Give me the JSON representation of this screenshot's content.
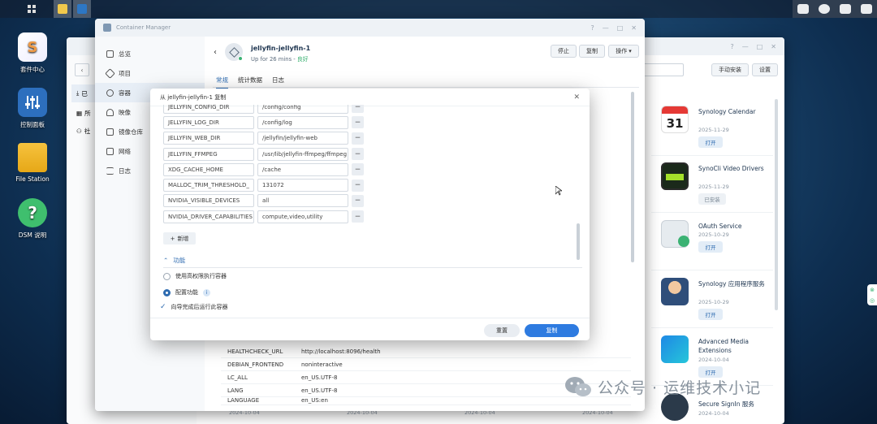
{
  "desktop": {
    "icons": [
      {
        "label": "套件中心",
        "icon": "package-center-icon"
      },
      {
        "label": "控制面板",
        "icon": "control-panel-icon"
      },
      {
        "label": "File Station",
        "icon": "folder-icon"
      },
      {
        "label": "DSM 说明",
        "icon": "help-icon"
      }
    ]
  },
  "package_window": {
    "manual_install_label": "手动安装",
    "settings_label": "设置",
    "packages": [
      {
        "name": "Synology Calendar",
        "date": "2025-11-29",
        "action": "打开",
        "icon": "calendar-icon",
        "icon_text": "31"
      },
      {
        "name": "SynoCli Video Drivers",
        "date": "2025-11-29",
        "action": "已安装",
        "icon": "video-drivers-icon"
      },
      {
        "name": "OAuth Service",
        "date": "2025-10-29",
        "action": "打开",
        "icon": "oauth-icon"
      },
      {
        "name": "Synology 应用程序服务",
        "date": "2025-10-29",
        "action": "打开",
        "icon": "app-service-icon"
      },
      {
        "name": "Advanced Media Extensions",
        "date": "2024-10-04",
        "action": "打开",
        "icon": "media-extensions-icon"
      },
      {
        "name": "Secure SignIn 服务",
        "date": "2024-10-04",
        "action": "",
        "icon": "secure-signin-icon"
      }
    ],
    "bottom_dates": [
      "2024-10-04",
      "2024-10-04",
      "2024-10-04",
      "2024-10-04"
    ]
  },
  "container_manager": {
    "title": "Container Manager",
    "sidebar": [
      {
        "label": "总览",
        "icon": "overview-icon"
      },
      {
        "label": "项目",
        "icon": "project-icon"
      },
      {
        "label": "容器",
        "icon": "container-icon"
      },
      {
        "label": "映像",
        "icon": "image-icon"
      },
      {
        "label": "镜像仓库",
        "icon": "registry-icon"
      },
      {
        "label": "网络",
        "icon": "network-icon"
      },
      {
        "label": "日志",
        "icon": "log-icon"
      }
    ],
    "container_name": "jellyfin-jellyfin-1",
    "status_prefix": "Up for 26 mins - ",
    "status_health": "良好",
    "stop_label": "停止",
    "copy_label": "复制",
    "actions_label": "操作",
    "tabs": [
      "常规",
      "统计数据",
      "日志"
    ],
    "env_rows": [
      {
        "key": "HEALTHCHECK_URL",
        "value": "http://localhost:8096/health"
      },
      {
        "key": "DEBIAN_FRONTEND",
        "value": "noninteractive"
      },
      {
        "key": "LC_ALL",
        "value": "en_US.UTF-8"
      },
      {
        "key": "LANG",
        "value": "en_US.UTF-8"
      },
      {
        "key": "LANGUAGE",
        "value": "en_US:en"
      }
    ],
    "partial_sidebar": [
      "已",
      "所",
      "社"
    ]
  },
  "dialog": {
    "title": "从 jellyfin-jellyfin-1 复制",
    "env": [
      {
        "key": "JELLYFIN_CONFIG_DIR",
        "value": "/config/config"
      },
      {
        "key": "JELLYFIN_LOG_DIR",
        "value": "/config/log"
      },
      {
        "key": "JELLYFIN_WEB_DIR",
        "value": "/jellyfin/jellyfin-web"
      },
      {
        "key": "JELLYFIN_FFMPEG",
        "value": "/usr/lib/jellyfin-ffmpeg/ffmpeg"
      },
      {
        "key": "XDG_CACHE_HOME",
        "value": "/cache"
      },
      {
        "key": "MALLOC_TRIM_THRESHOLD_",
        "value": "131072"
      },
      {
        "key": "NVIDIA_VISIBLE_DEVICES",
        "value": "all"
      },
      {
        "key": "NVIDIA_DRIVER_CAPABILITIES",
        "value": "compute,video,utility"
      }
    ],
    "add_label": "新增",
    "section_label": "功能",
    "options": [
      {
        "label": "使用高权限执行容器",
        "checked": false
      },
      {
        "label": "配置功能",
        "checked": true
      },
      {
        "label": "向导完成后运行此容器",
        "checked": true
      }
    ],
    "reset_label": "重置",
    "copy_label": "复制"
  },
  "watermark": "公众号 · 运维技术小记"
}
